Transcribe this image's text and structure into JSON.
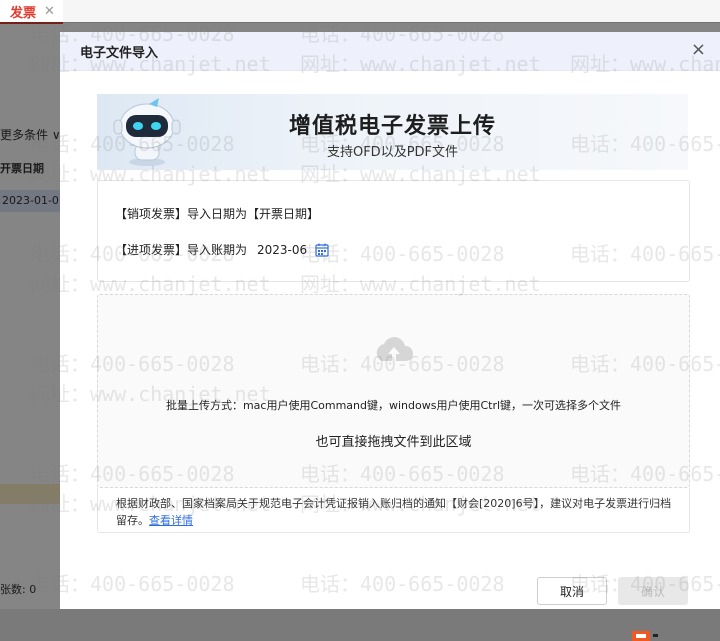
{
  "background": {
    "tab_label": "发票",
    "tab_close": "✕",
    "more_filters": "更多条件 ∨",
    "column_header": "开票日期",
    "selected_row_date": "2023-01-0",
    "footer_count": "张数: 0"
  },
  "modal": {
    "title": "电子文件导入",
    "close": "×",
    "banner": {
      "title": "增值税电子发票上传",
      "subtitle": "支持OFD以及PDF文件"
    },
    "sales_invoice_line": "【销项发票】导入日期为【开票日期】",
    "input_invoice_label": "【进项发票】导入账期为",
    "period_value": "2023-06",
    "drop_zone": {
      "hint_batch": "批量上传方式：mac用户使用Command键，windows用户使用Ctrl键，一次可选择多个文件",
      "hint_drag": "也可直接拖拽文件到此区域"
    },
    "notice": {
      "text": "根据财政部、国家档案局关于规范电子会计凭证报销入账归档的通知【财会[2020]6号】，建议对电子发票进行归档留存。",
      "link": "查看详情"
    },
    "cancel_label": "取消",
    "confirm_label": "确认"
  },
  "watermark": {
    "phone": "电话：400-665-0028",
    "site": "网址：www.chanjet.net"
  },
  "colors": {
    "accent_red": "#e23a2e",
    "link_blue": "#2f6de1",
    "header_bg": "#eef1fb"
  }
}
